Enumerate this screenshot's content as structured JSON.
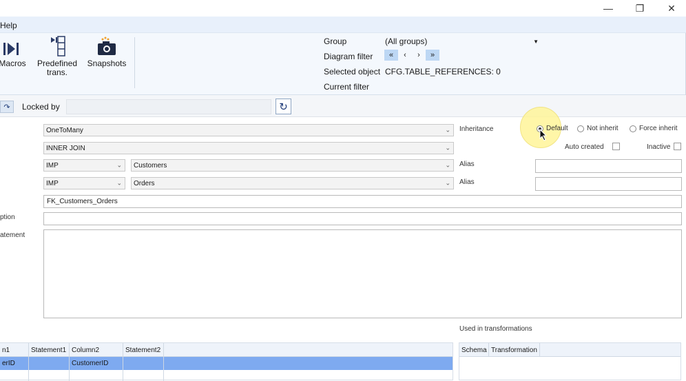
{
  "window": {
    "minimize_glyph": "—",
    "restore_glyph": "❐",
    "close_glyph": "✕"
  },
  "menu": {
    "help": "Help"
  },
  "ribbon": {
    "macros": "Macros",
    "predefined_line1": "Predefined",
    "predefined_line2": "trans.",
    "snapshots": "Snapshots",
    "group_label": "Group",
    "group_value": "(All groups)",
    "diagram_filter_label": "Diagram filter",
    "nav": {
      "first": "«",
      "prev": "‹",
      "next": "›",
      "last": "»"
    },
    "selected_object_label": "Selected object",
    "selected_object_value": "CFG.TABLE_REFERENCES: 0",
    "current_filter_label": "Current filter"
  },
  "toolbar": {
    "locked_by_label": "Locked by",
    "locked_by_value": ""
  },
  "form": {
    "cardinality": "OneToMany",
    "join_type": "INNER JOIN",
    "left_schema": "IMP",
    "left_table": "Customers",
    "right_schema": "IMP",
    "right_table": "Orders",
    "name_value": "FK_Customers_Orders",
    "description_label": "ption",
    "statement_label": "atement",
    "inheritance_label": "Inheritance",
    "inheritance_options": [
      "Default",
      "Not inherit",
      "Force inherit"
    ],
    "inheritance_selected": "Default",
    "auto_created_label": "Auto created",
    "inactive_label": "Inactive",
    "alias1_label": "Alias",
    "alias2_label": "Alias",
    "used_in_label": "Used in transformations"
  },
  "columns_grid": {
    "headers": [
      "n1",
      "Statement1",
      "Column2",
      "Statement2"
    ],
    "rows": [
      [
        "erID",
        "",
        "CustomerID",
        ""
      ]
    ]
  },
  "transform_grid": {
    "headers": [
      "Schema",
      "Transformation"
    ]
  },
  "colors": {
    "selection": "#7eaaf0",
    "ribbon": "#f4f8fd",
    "menubar": "#e8f0fb",
    "highlight": "#fff59a"
  }
}
